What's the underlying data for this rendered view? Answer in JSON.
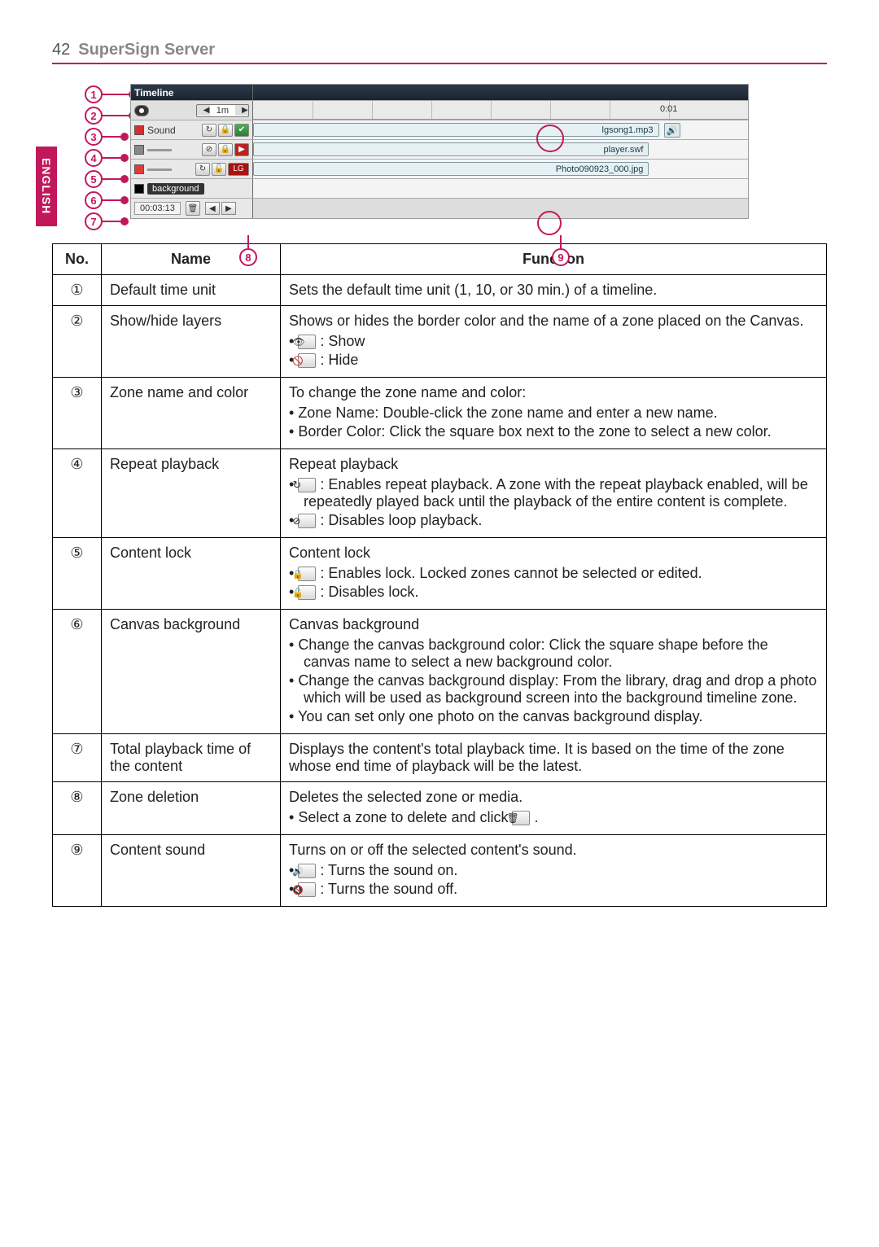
{
  "page": {
    "number": "42",
    "title": "SuperSign Server",
    "side_tab": "ENGLISH"
  },
  "figure": {
    "header_tab": "Timeline",
    "time_unit": "1m",
    "ruler_label": "0:01",
    "sound_zone": "Sound",
    "sound_track": "lgsong1.mp3",
    "swf_track": "player.swf",
    "photo_track": "Photo090923_000.jpg",
    "bg_label": "background",
    "timecode": "00:03:13",
    "markers": {
      "1": "1",
      "2": "2",
      "3": "3",
      "4": "4",
      "5": "5",
      "6": "6",
      "7": "7",
      "8": "8",
      "9": "9"
    }
  },
  "table": {
    "head": {
      "no": "No.",
      "name": "Name",
      "func": "Function"
    },
    "rows": [
      {
        "no": "①",
        "name": "Default time unit",
        "func_plain": "Sets the default time unit (1, 10, or 30 min.) of a timeline."
      },
      {
        "no": "②",
        "name": "Show/hide layers",
        "func_lead": "Shows or hides the border color and the name of a zone placed on the Canvas.",
        "bullets": [
          {
            "icon": "eye",
            "text": " : Show"
          },
          {
            "icon": "hide",
            "text": " : Hide"
          }
        ]
      },
      {
        "no": "③",
        "name": "Zone name and color",
        "func_lead": "To change the zone name and color:",
        "bullets": [
          {
            "text": "Zone Name: Double-click the zone name and enter a new name."
          },
          {
            "text": "Border Color: Click the square box next to the zone to select a new color."
          }
        ]
      },
      {
        "no": "④",
        "name": "Repeat playback",
        "func_lead": "Repeat playback",
        "bullets": [
          {
            "icon": "repeat",
            "text": " : Enables repeat playback. A zone with the repeat playback enabled, will be repeatedly played back until the playback of the entire content is complete."
          },
          {
            "icon": "norepeat",
            "text": " : Disables loop playback."
          }
        ]
      },
      {
        "no": "⑤",
        "name": "Content lock",
        "func_lead": "Content lock",
        "bullets": [
          {
            "icon": "lock",
            "text": " : Enables lock. Locked zones cannot be selected or edited."
          },
          {
            "icon": "unlock",
            "text": " : Disables lock."
          }
        ]
      },
      {
        "no": "⑥",
        "name": "Canvas background",
        "func_lead": "Canvas background",
        "bullets": [
          {
            "text": "Change the canvas background color: Click the square shape before the canvas name to select a new background color."
          },
          {
            "text": "Change the canvas background display: From the library, drag and drop a photo which will be used as background screen into the background timeline zone."
          },
          {
            "text": "You can set only one photo on the canvas background display."
          }
        ]
      },
      {
        "no": "⑦",
        "name": "Total playback time of the content",
        "func_plain": "Displays the content's total playback time. It is based on the time of the zone whose end time of playback will be the latest."
      },
      {
        "no": "⑧",
        "name": "Zone deletion",
        "func_lead": "Deletes the selected zone or media.",
        "bullets": [
          {
            "icon_after": "trash",
            "text": "Select a zone to delete and click ",
            "tail": " ."
          }
        ]
      },
      {
        "no": "⑨",
        "name": "Content sound",
        "func_lead": "Turns on or off the selected content's sound.",
        "bullets": [
          {
            "icon": "sound-on",
            "text": " : Turns the sound on."
          },
          {
            "icon": "sound-off",
            "text": " : Turns the sound off."
          }
        ]
      }
    ]
  }
}
